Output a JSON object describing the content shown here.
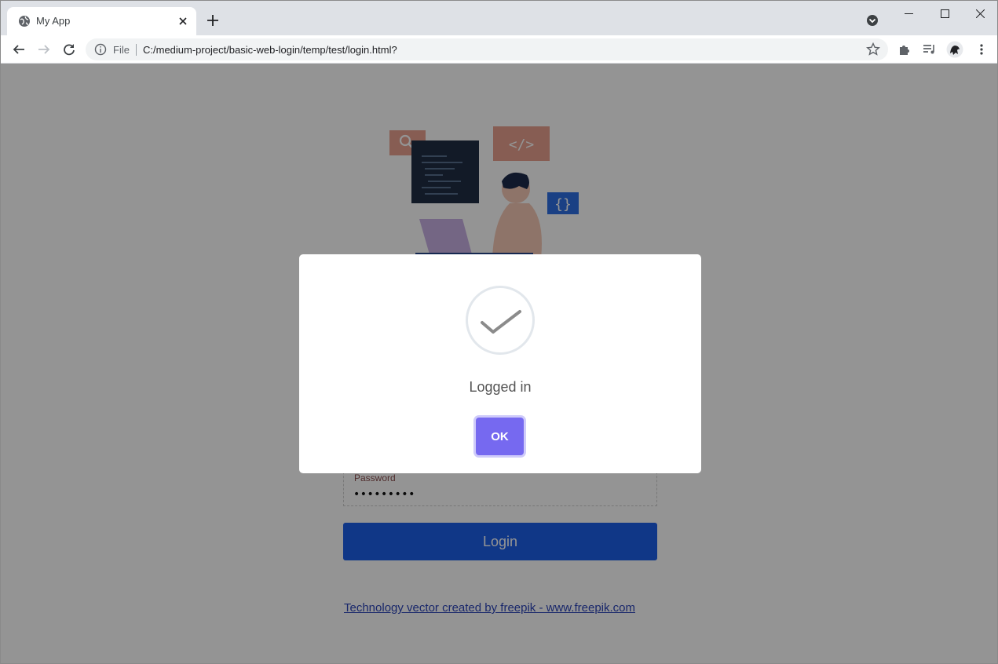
{
  "browser": {
    "tab_title": "My App",
    "scheme_label": "File",
    "url": "C:/medium-project/basic-web-login/temp/test/login.html?",
    "icons": {
      "favicon": "globe-icon",
      "tab_close": "close-icon",
      "new_tab": "plus-icon",
      "tab_search": "tab-search-icon",
      "back": "arrow-left-icon",
      "forward": "arrow-right-icon",
      "reload": "reload-icon",
      "info": "info-icon",
      "bookmark": "star-icon",
      "extensions": "puzzle-icon",
      "media": "media-queue-icon",
      "profile": "avatar",
      "menu": "kebab-menu-icon"
    }
  },
  "page": {
    "password_label": "Password",
    "password_value": "•••••••••",
    "login_button_label": "Login",
    "credit_link": "Technology vector created by freepik - www.freepik.com",
    "colors": {
      "login_button": "#1c5fe8",
      "link": "#2b44b8"
    }
  },
  "modal": {
    "message": "Logged in",
    "ok_label": "OK",
    "icon": "success-check-icon",
    "colors": {
      "ok_button": "#7669f0",
      "overlay": "rgba(0,0,0,0.42)"
    }
  }
}
